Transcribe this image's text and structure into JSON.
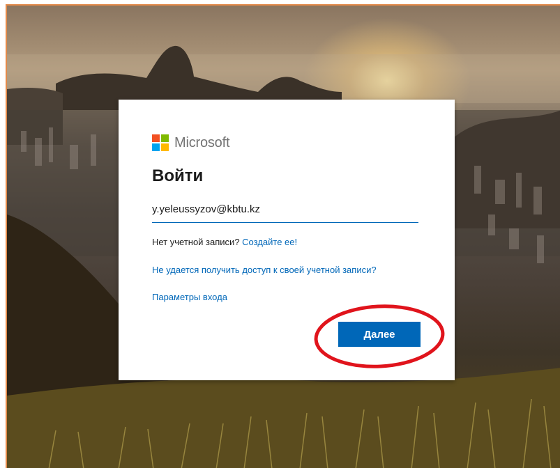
{
  "signin": {
    "brand": "Microsoft",
    "title": "Войти",
    "email_value": "y.yeleussyzov@kbtu.kz",
    "no_account_text": "Нет учетной записи?",
    "create_link": "Создайте ее!",
    "cant_access_link": "Не удается получить доступ к своей учетной записи?",
    "signin_options_link": "Параметры входа",
    "next_button": "Далее"
  },
  "colors": {
    "accent": "#0067b8",
    "logo_red": "#f25022",
    "logo_green": "#7fba00",
    "logo_blue": "#00a4ef",
    "logo_yellow": "#ffb900",
    "annotation_red": "#e0141c",
    "frame_border": "#e38a4a"
  },
  "icons": {
    "logo": "microsoft-logo-icon"
  }
}
